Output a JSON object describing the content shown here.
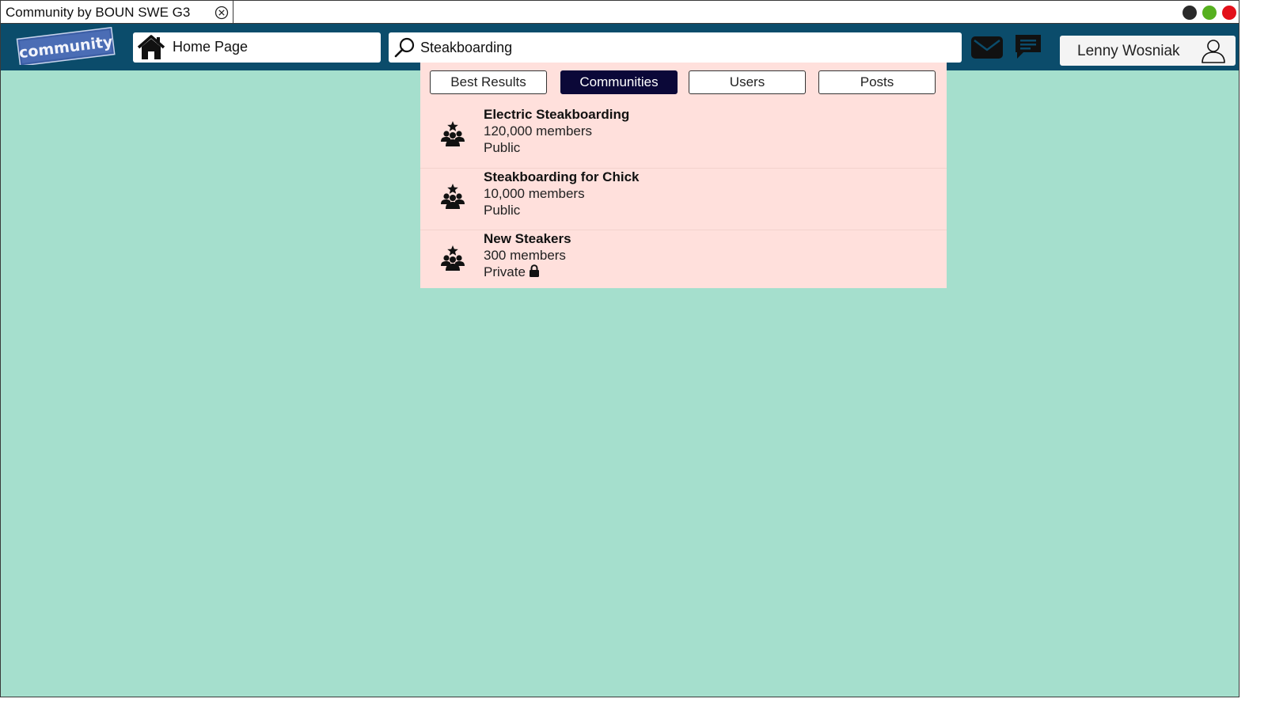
{
  "window": {
    "tab_title": "Community by BOUN SWE G3",
    "controls": [
      {
        "name": "dark",
        "color": "#2a2a2a"
      },
      {
        "name": "green",
        "color": "#56b01f"
      },
      {
        "name": "red",
        "color": "#e3101a"
      }
    ]
  },
  "header": {
    "logo_text": "community",
    "home_label": "Home Page",
    "search_value": "Steakboarding",
    "user_name": "Lenny Wosniak"
  },
  "search_dropdown": {
    "filters": [
      {
        "label": "Best Results",
        "active": false
      },
      {
        "label": "Communities",
        "active": true
      },
      {
        "label": "Users",
        "active": false
      },
      {
        "label": "Posts",
        "active": false
      }
    ],
    "results": [
      {
        "name": "Electric Steakboarding",
        "members": "120,000 members",
        "privacy": "Public",
        "locked": false
      },
      {
        "name": "Steakboarding for Chick",
        "members": "10,000 members",
        "privacy": "Public",
        "locked": false
      },
      {
        "name": "New Steakers",
        "members": "300 members",
        "privacy": "Private",
        "locked": true
      }
    ]
  },
  "colors": {
    "navbar": "#0b4c6b",
    "background": "#a5dfcd",
    "dropdown": "#ffe0dc",
    "active_filter": "#0b0838"
  }
}
